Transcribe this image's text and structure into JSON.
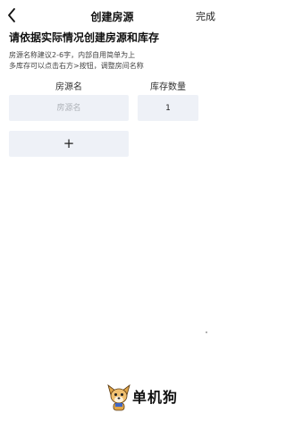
{
  "nav": {
    "title": "创建房源",
    "done_label": "完成"
  },
  "heading": "请依据实际情况创建房源和库存",
  "hint": {
    "line1": "房源名称建议2-6字，内部自用简单为上",
    "line2": "多库存可以点击右方>按钮，调整房间名称"
  },
  "columns": {
    "name_header": "房源名",
    "stock_header": "库存数量"
  },
  "row": {
    "name_placeholder": "房源名",
    "name_value": "",
    "stock_value": "1"
  },
  "add_button": {
    "label": "+"
  },
  "watermark": {
    "text": "单机狗",
    "icon": "dog-mascot-icon"
  }
}
